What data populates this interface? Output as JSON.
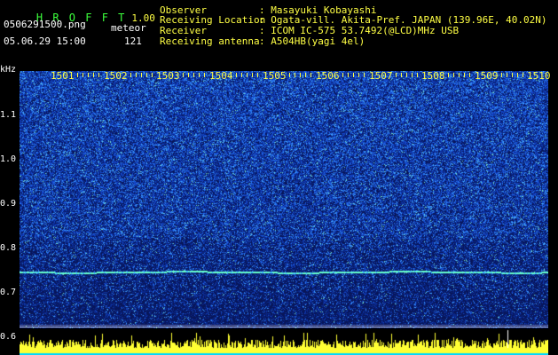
{
  "header": {
    "logo": "H R O F F T",
    "version": "1.00",
    "filename": "0506291500.png",
    "mode_label": "meteor",
    "datetime": "05.06.29 15:00",
    "count": "121"
  },
  "info": {
    "observer_label": "Observer",
    "observer_value": ": Masayuki Kobayashi",
    "location_label": "Receiving Location",
    "location_value": ": Ogata-vill. Akita-Pref. JAPAN (139.96E, 40.02N)",
    "receiver_label": "Receiver",
    "receiver_value": ": ICOM IC-575 53.7492(@LCD)MHz USB",
    "antenna_label": "Receiving antenna",
    "antenna_value": ": A504HB(yagi 4el)"
  },
  "axis": {
    "y_unit": "kHz",
    "y_ticks": [
      "1.1",
      "1.0",
      "0.9",
      "0.8",
      "0.7",
      "0.6"
    ],
    "x_ticks": [
      "1501",
      "1502",
      "1503",
      "1504",
      "1505",
      "1506",
      "1507",
      "1508",
      "1509",
      "1510"
    ]
  },
  "colors": {
    "background": "#000000",
    "spectrogram_base": "#0c1c5a",
    "noise_high": "#2f7bff",
    "signal_line": "#66ffcc",
    "label_yellow": "#ffff44",
    "logo_green": "#3cff3c",
    "amplitude_bars": "#ffff33",
    "amplitude_base": "#00d8ff"
  }
}
